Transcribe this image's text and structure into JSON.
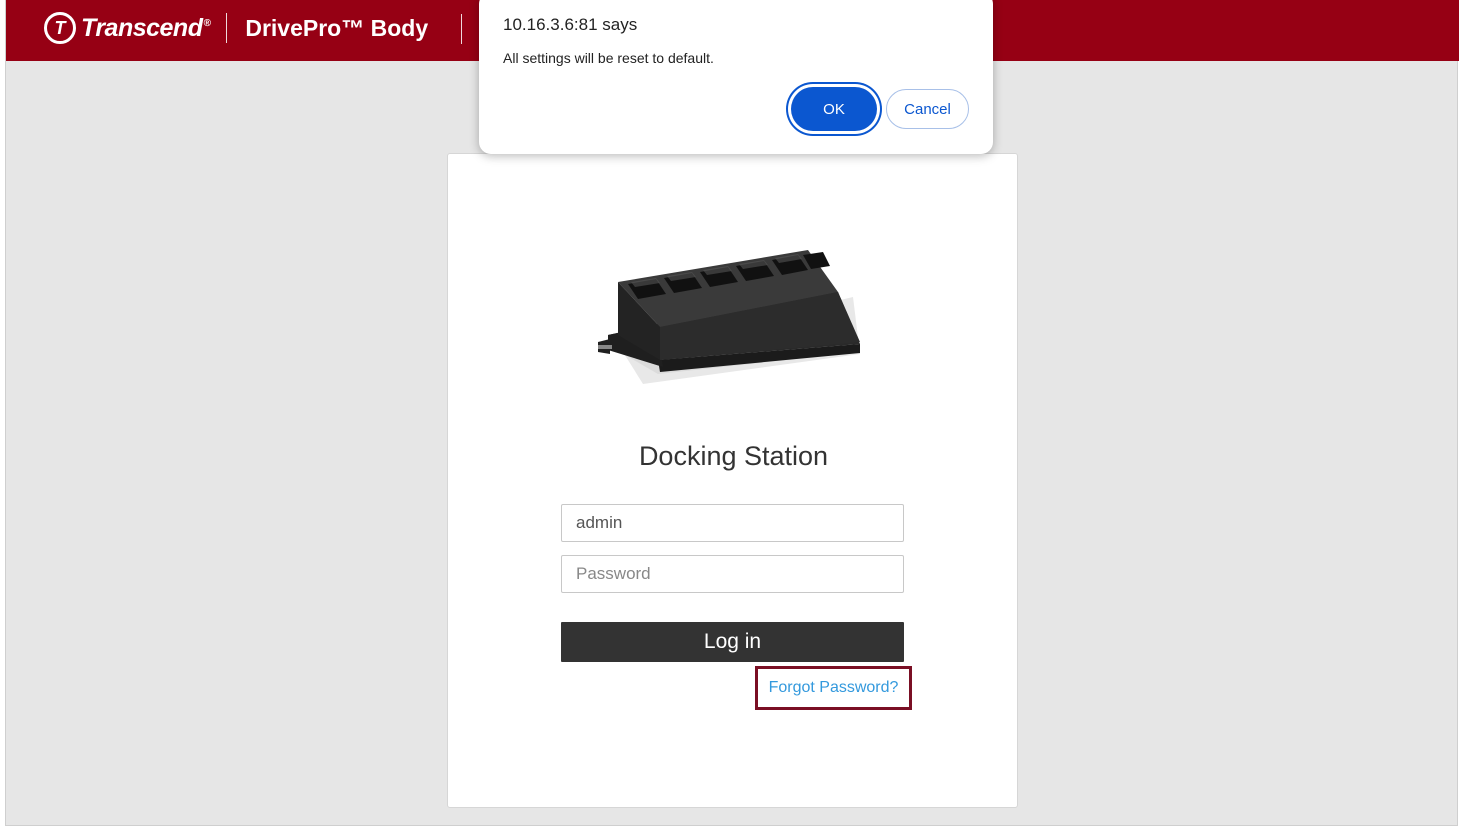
{
  "header": {
    "brand_logo_letter": "T",
    "brand_name": "Transcend",
    "brand_reg": "®",
    "product_name": "DrivePro™ Body",
    "bg_color": "#960014"
  },
  "login": {
    "title": "Docking Station",
    "username_value": "admin",
    "password_placeholder": "Password",
    "login_label": "Log in",
    "forgot_label": "Forgot Password?",
    "link_color": "#3399dd",
    "button_color": "#333333"
  },
  "dialog": {
    "origin": "10.16.3.6:81 says",
    "message": "All settings will be reset to default.",
    "ok_label": "OK",
    "cancel_label": "Cancel",
    "accent_color": "#0b57d0"
  },
  "icons": {
    "brand_logo": "transcend-logo-icon",
    "dock_image": "docking-station-image"
  }
}
